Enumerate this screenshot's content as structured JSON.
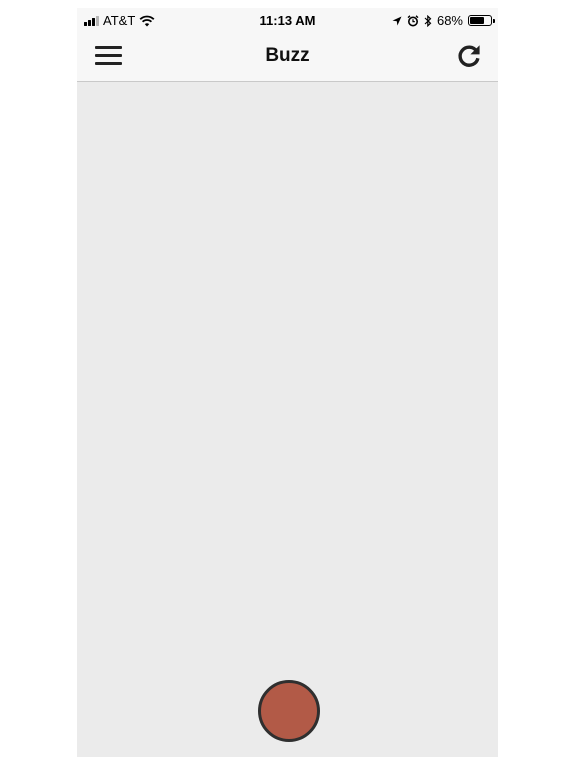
{
  "status_bar": {
    "carrier": "AT&T",
    "time": "11:13 AM",
    "battery_percent": "68%",
    "battery_level": 0.68,
    "signal_bars_filled": 3,
    "signal_bars_total": 4,
    "icons": [
      "signal-icon",
      "wifi-icon",
      "location-arrow-icon",
      "alarm-icon",
      "bluetooth-icon",
      "battery-icon"
    ]
  },
  "nav": {
    "title": "Buzz",
    "left_icon": "menu-icon",
    "right_icon": "refresh-icon"
  },
  "main": {
    "record_button_icon": "record-button",
    "colors": {
      "background": "#ebebeb",
      "button_fill": "#b25a47",
      "button_border": "#2f2f2f"
    }
  }
}
